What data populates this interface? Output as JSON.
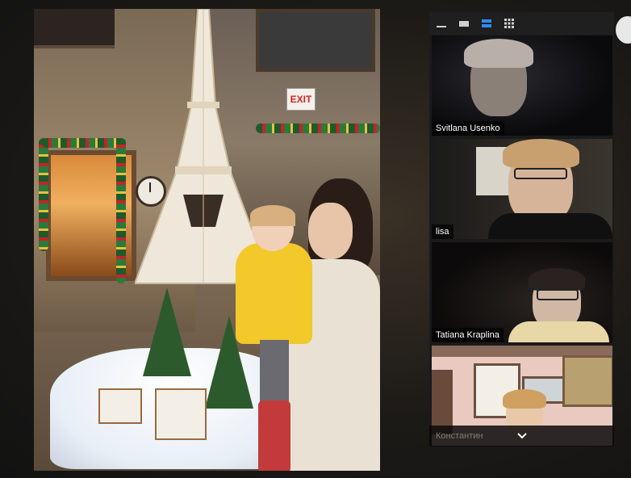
{
  "shared_content": {
    "exit_sign": "EXIT"
  },
  "gallery": {
    "toolbar": {
      "icons": [
        "minimize-icon",
        "hide-video-icon",
        "speaker-view-icon",
        "gallery-view-icon"
      ],
      "active_color": "#2d8cff"
    },
    "participants": [
      {
        "name": "Svitlana Usenko"
      },
      {
        "name": "lisa"
      },
      {
        "name": "Tatiana Kraplina"
      },
      {
        "name": "Константин"
      }
    ],
    "scroll": {
      "icon": "chevron-down-icon"
    }
  },
  "colors": {
    "raincoat": "#f2c82a",
    "panel_bg": "#1a1a1a",
    "name_text": "#ffffff"
  }
}
